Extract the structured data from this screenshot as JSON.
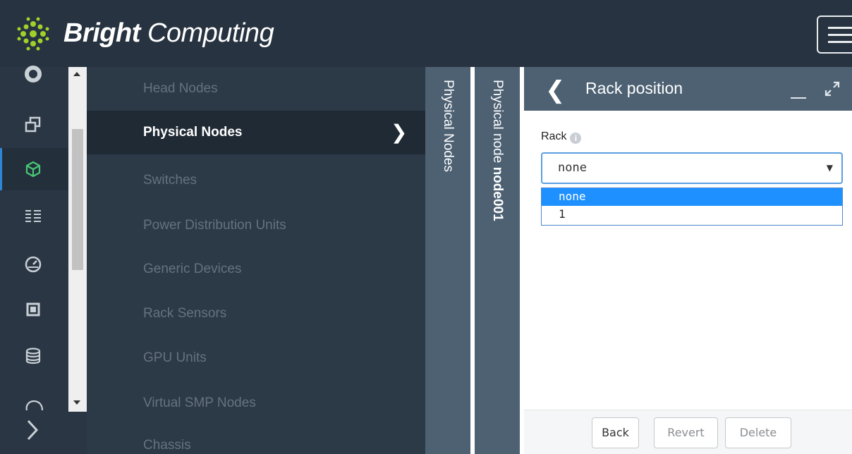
{
  "brand": {
    "bold": "Bright",
    "light": "Computing"
  },
  "rail": {
    "icons": [
      "circle-icon",
      "windows-icon",
      "cube-icon",
      "list-icon",
      "gauge-icon",
      "chip-icon",
      "database-icon",
      "cloud-icon"
    ],
    "active_index": 2,
    "accent": "#2f86d6"
  },
  "nav": {
    "items": [
      {
        "label": "Head Nodes"
      },
      {
        "label": "Physical Nodes",
        "active": true
      },
      {
        "label": "Switches"
      },
      {
        "label": "Power Distribution Units"
      },
      {
        "label": "Generic Devices"
      },
      {
        "label": "Rack Sensors"
      },
      {
        "label": "GPU Units"
      },
      {
        "label": "Virtual SMP Nodes"
      },
      {
        "label": "Chassis"
      }
    ],
    "chevron": "❯"
  },
  "breadcrumbs": {
    "level1": "Physical Nodes",
    "level2_prefix": "Physical node ",
    "level2_name": "node001"
  },
  "panel": {
    "title": "Rack position",
    "back_glyph": "❮",
    "field_label": "Rack",
    "info_glyph": "i",
    "select_value": "none",
    "select_caret": "▼",
    "options": [
      "none",
      "1"
    ],
    "selected_option": "none",
    "buttons": {
      "back": "Back",
      "revert": "Revert",
      "delete": "Delete"
    }
  }
}
